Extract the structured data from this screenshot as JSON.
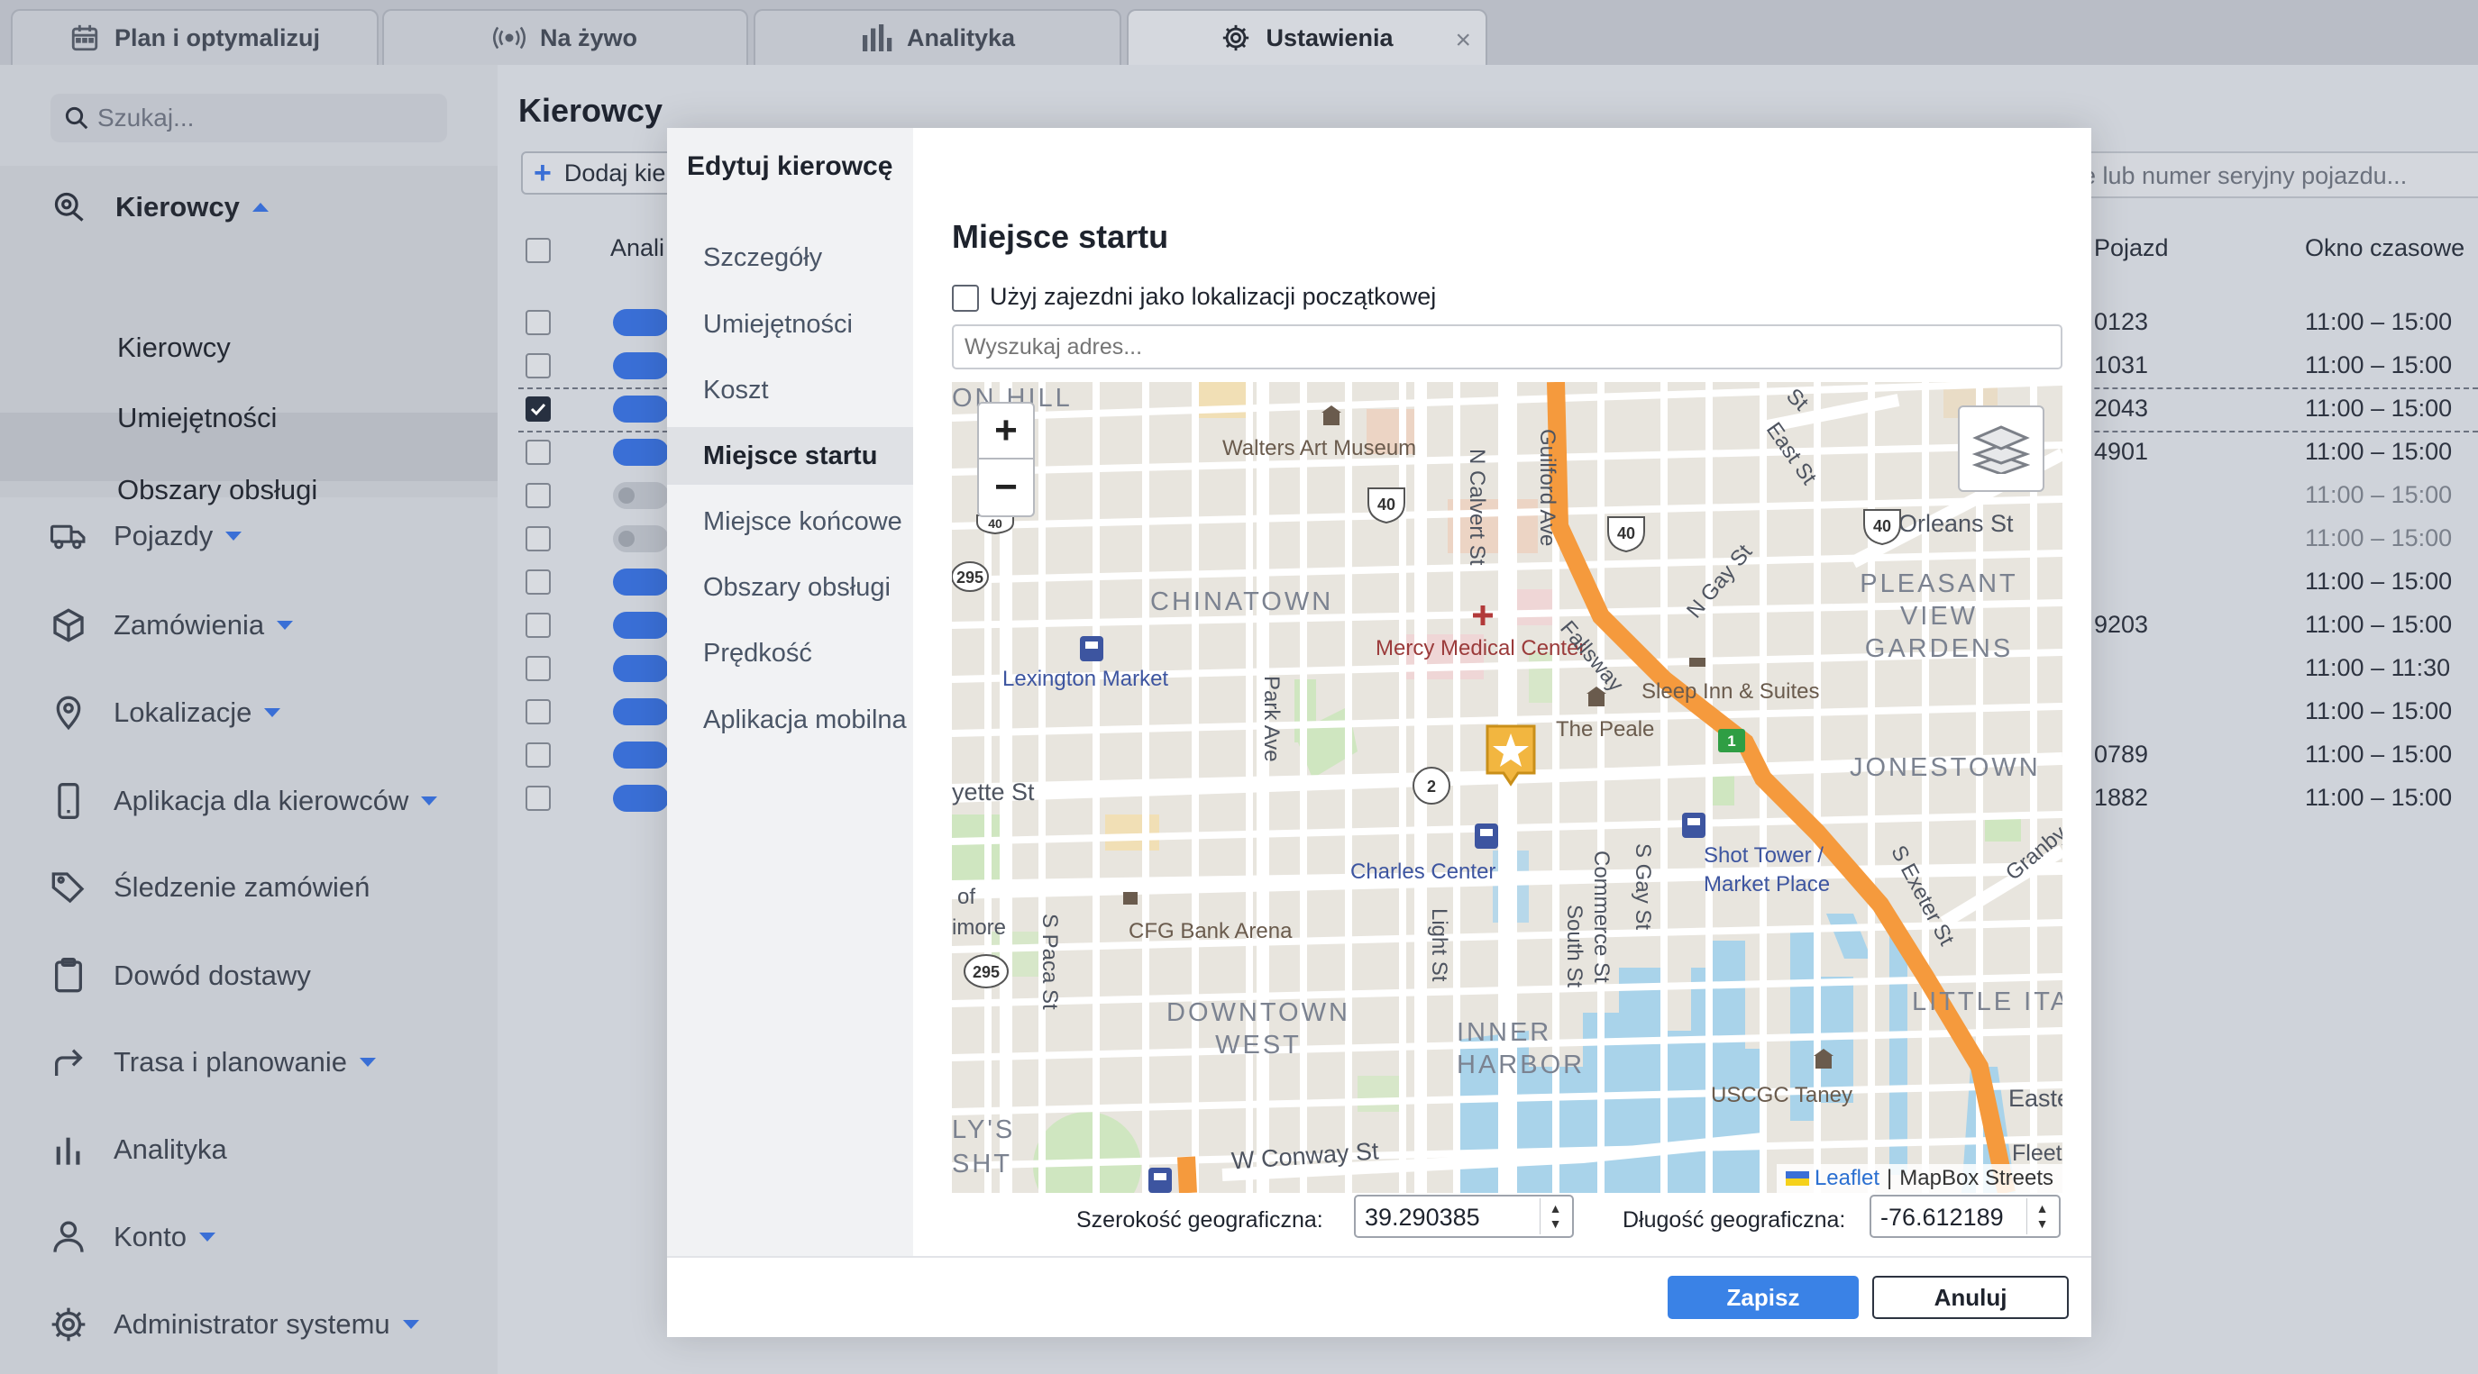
{
  "tabs": [
    {
      "label": "Plan i optymalizuj",
      "icon": "calendar-icon"
    },
    {
      "label": "Na żywo",
      "icon": "broadcast-icon"
    },
    {
      "label": "Analityka",
      "icon": "bar-chart-icon"
    },
    {
      "label": "Ustawienia",
      "icon": "gear-icon",
      "active": true,
      "close": "×"
    }
  ],
  "sidebar": {
    "search_placeholder": "Szukaj...",
    "drivers_section": {
      "label": "Kierowcy",
      "subitems": [
        "Kierowcy",
        "Umiejętności",
        "Obszary obsługi"
      ],
      "selected": "Kierowcy"
    },
    "items": [
      {
        "label": "Pojazdy",
        "icon": "truck-icon",
        "caret": true
      },
      {
        "label": "Zamówienia",
        "icon": "box-icon",
        "caret": true
      },
      {
        "label": "Lokalizacje",
        "icon": "map-pin-icon",
        "caret": true
      },
      {
        "label": "Aplikacja dla kierowców",
        "icon": "smartphone-icon",
        "caret": true
      },
      {
        "label": "Śledzenie zamówień",
        "icon": "tag-icon",
        "caret": false
      },
      {
        "label": "Dowód dostawy",
        "icon": "clipboard-icon",
        "caret": false
      },
      {
        "label": "Trasa i planowanie",
        "icon": "route-arrow-icon",
        "caret": true
      },
      {
        "label": "Analityka",
        "icon": "bar-chart-icon",
        "caret": false
      },
      {
        "label": "Konto",
        "icon": "user-icon",
        "caret": true
      },
      {
        "label": "Administrator systemu",
        "icon": "gear-icon",
        "caret": true
      }
    ]
  },
  "main": {
    "title": "Kierowcy",
    "add_button": "Dodaj kie",
    "vehicle_search_placeholder": "e lub numer seryjny pojazdu...",
    "columns": {
      "analytics": "Anali",
      "vehicle": "Pojazd",
      "time_window": "Okno czasowe"
    },
    "rows": [
      {
        "enabled": true,
        "checked": false,
        "vehicle": "0123",
        "window": "11:00 – 15:00"
      },
      {
        "enabled": true,
        "checked": false,
        "vehicle": "1031",
        "window": "11:00 – 15:00"
      },
      {
        "enabled": true,
        "checked": true,
        "vehicle": "2043",
        "window": "11:00 – 15:00"
      },
      {
        "enabled": true,
        "checked": false,
        "vehicle": "4901",
        "window": "11:00 – 15:00"
      },
      {
        "enabled": false,
        "checked": false,
        "vehicle": "",
        "window": "11:00 – 15:00"
      },
      {
        "enabled": false,
        "checked": false,
        "vehicle": "",
        "window": "11:00 – 15:00"
      },
      {
        "enabled": true,
        "checked": false,
        "vehicle": "",
        "window": "11:00 – 15:00"
      },
      {
        "enabled": true,
        "checked": false,
        "vehicle": "9203",
        "window": "11:00 – 15:00"
      },
      {
        "enabled": true,
        "checked": false,
        "vehicle": "",
        "window": "11:00 – 11:30"
      },
      {
        "enabled": true,
        "checked": false,
        "vehicle": "",
        "window": "11:00 – 15:00"
      },
      {
        "enabled": true,
        "checked": false,
        "vehicle": "0789",
        "window": "11:00 – 15:00"
      },
      {
        "enabled": true,
        "checked": false,
        "vehicle": "1882",
        "window": "11:00 – 15:00"
      }
    ]
  },
  "modal": {
    "title": "Edytuj kierowcę",
    "nav": [
      "Szczegóły",
      "Umiejętności",
      "Koszt",
      "Miejsce startu",
      "Miejsce końcowe",
      "Obszary obsługi",
      "Prędkość",
      "Aplikacja mobilna"
    ],
    "active_nav": "Miejsce startu",
    "section_title": "Miejsce startu",
    "use_depot_label": "Użyj zajezdni jako lokalizacji początkowej",
    "use_depot_checked": false,
    "address_placeholder": "Wyszukaj adres...",
    "map": {
      "zoom_in": "+",
      "zoom_out": "−",
      "labels": {
        "walters": "Walters Art Museum",
        "chinatown": "CHINATOWN",
        "mercy": "Mercy Medical Center",
        "lexington": "Lexington Market",
        "sleep_inn": "Sleep Inn & Suites",
        "peale": "The Peale",
        "pleasant_view": "PLEASANT VIEW GARDENS",
        "orleans": "Orleans St",
        "jonestown": "JONESTOWN",
        "charles_center": "Charles Center",
        "shot_tower": "Shot Tower / Market Place",
        "cfg": "CFG Bank Arena",
        "downtown_west": "DOWNTOWN WEST",
        "inner_harbor": "INNER HARBOR",
        "little_italy": "LITTLE ITA",
        "uscgc": "USCGC Taney",
        "conway": "W Conway St",
        "fayette": "yette St",
        "on_hill": "ON HILL",
        "calvert": "N Calvert St",
        "guilford": "Guilford Ave",
        "fallsway": "Fallsway",
        "n_gay": "N Gay St",
        "east": "East St",
        "park": "Park Ave",
        "light": "Light St",
        "south": "South St",
        "commerce": "Commerce St",
        "s_gay": "S Gay St",
        "s_paca": "S Paca St",
        "s_exeter": "S Exeter St",
        "granby": "Granby",
        "of": "of",
        "imore": "imore",
        "lys": "LY'S",
        "sht": "SHT",
        "easte": "Easte",
        "fleet": "Fleet",
        "st_frag": "St"
      },
      "shields": [
        "295",
        "40",
        "40",
        "40",
        "295",
        "2",
        "1",
        "40"
      ],
      "attribution": {
        "leaflet": "Leaflet",
        "tiles": "MapBox Streets",
        "separator": "|"
      },
      "colors": {
        "primary_road": "#f59a3d",
        "water": "#a9d3ea",
        "park": "#cfe6c0",
        "marker": "#f2b640"
      }
    },
    "latitude_label": "Szerokość geograficzna:",
    "latitude_value": "39.290385",
    "longitude_label": "Długość geograficzna:",
    "longitude_value": "-76.612189",
    "save_label": "Zapisz",
    "cancel_label": "Anuluj"
  }
}
